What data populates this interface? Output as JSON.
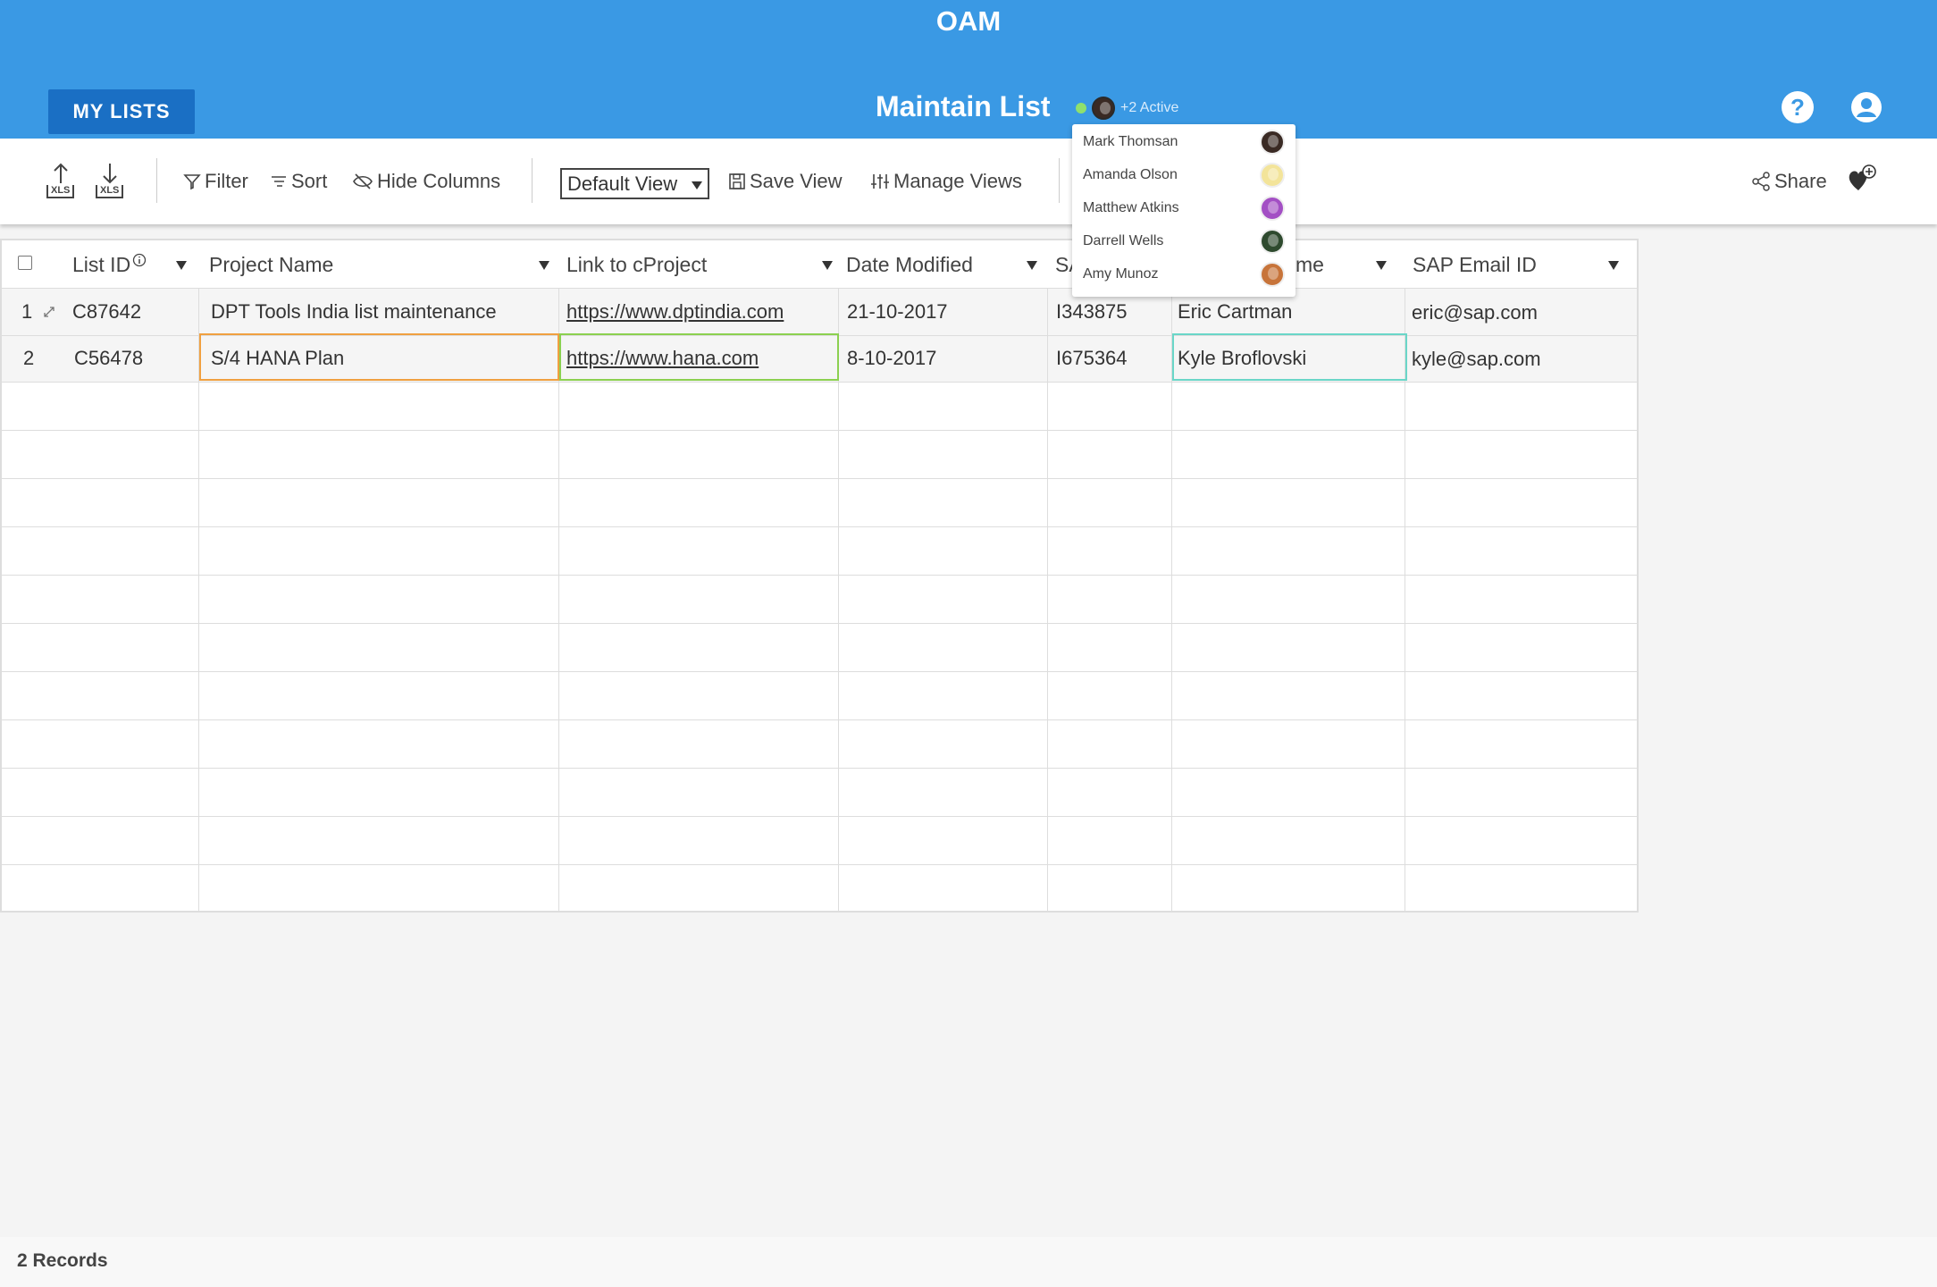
{
  "header": {
    "app_title": "OAM",
    "my_lists_label": "MY LISTS",
    "page_title": "Maintain List",
    "presence_text": "+2 Active",
    "help_icon": "help-icon",
    "user_icon": "user-account-icon"
  },
  "toolbar": {
    "upload_label": "XLS",
    "download_label": "XLS",
    "filter_label": "Filter",
    "sort_label": "Sort",
    "hide_columns_label": "Hide Columns",
    "view_selected": "Default View",
    "save_view_label": "Save View",
    "manage_views_label": "Manage Views",
    "share_label": "Share"
  },
  "active_users": [
    {
      "name": "Mark Thomsan",
      "color": "#3a2a24"
    },
    {
      "name": "Amanda Olson",
      "color": "#f3e49a"
    },
    {
      "name": "Matthew Atkins",
      "color": "#a34fc4"
    },
    {
      "name": "Darrell Wells",
      "color": "#2e4a2e"
    },
    {
      "name": "Amy Munoz",
      "color": "#c7743a"
    }
  ],
  "table": {
    "columns": [
      "List ID",
      "Project Name",
      "Link to cProject",
      "Date Modified",
      "SA",
      "me",
      "SAP Email ID"
    ],
    "rows": [
      {
        "num": "1",
        "list_id": "C87642",
        "project": "DPT Tools India list maintenance",
        "link": "https://www.dptindia.com",
        "date": "21-10-2017",
        "sap_id": "I343875",
        "name": "Eric Cartman",
        "email": "eric@sap.com"
      },
      {
        "num": "2",
        "list_id": "C56478",
        "project": "S/4 HANA Plan",
        "link": "https://www.hana.com",
        "date": "8-10-2017",
        "sap_id": "I675364",
        "name": "Kyle Broflovski",
        "email": "kyle@sap.com"
      }
    ]
  },
  "colors": {
    "header_bg": "#3a99e4",
    "button_bg": "#1a6fc4",
    "sel_orange": "#f0a040",
    "sel_green": "#8cd050",
    "sel_teal": "#6ad6c8"
  },
  "footer": {
    "records_label": "2 Records"
  }
}
